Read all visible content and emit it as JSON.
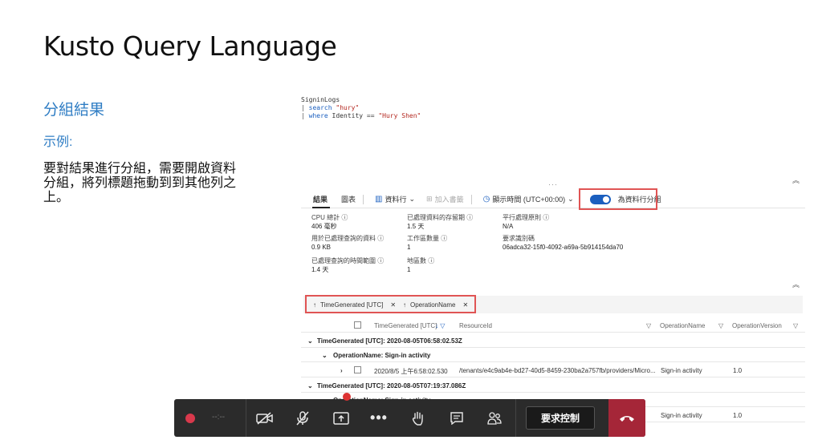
{
  "slide": {
    "title": "Kusto Query Language",
    "heading": "分組結果",
    "example_label": "示例:",
    "body": "要對結果進行分組，需要開啟資料分組，將列標題拖動到到其他列之上。"
  },
  "query": {
    "line1": "SigninLogs",
    "line2_kw": "search",
    "line2_str": "\"hury\"",
    "line3_kw": "where",
    "line3_mid": " Identity == ",
    "line3_str": "\"Hury Shen\""
  },
  "toolbar": {
    "results_tab": "結果",
    "chart_tab": "圖表",
    "columns": "資料行",
    "add_bookmark": "加入書籤",
    "time_display": "顯示時間 (UTC+00:00)",
    "group_toggle": "為資料行分組",
    "group_toggle_on": true
  },
  "stats": {
    "cpu_label": "CPU 總計 ⓘ",
    "cpu_value": "406 毫秒",
    "data_label": "用於已處理查詢的資料 ⓘ",
    "data_value": "0.9 KB",
    "range_label": "已處理查詢的時間範圍 ⓘ",
    "range_value": "1.4 天",
    "retention_label": "已處理資料的存留期 ⓘ",
    "retention_value": "1.5 天",
    "workspaces_label": "工作區數量 ⓘ",
    "workspaces_value": "1",
    "regions_label": "地區數 ⓘ",
    "regions_value": "1",
    "parallel_label": "平行處理原則 ⓘ",
    "parallel_value": "N/A",
    "request_label": "要求識別碼",
    "request_value": "06adca32-15f0-4092-a69a-5b914154da70"
  },
  "grouping": {
    "chip1": "TimeGenerated [UTC]",
    "chip2": "OperationName"
  },
  "table": {
    "headers": {
      "time": "TimeGenerated [UTC]",
      "resource": "ResourceId",
      "operation": "OperationName",
      "version": "OperationVersion"
    },
    "group1": "TimeGenerated [UTC]: 2020-08-05T06:58:02.53Z",
    "subgroup1": "OperationName: Sign-in activity",
    "row1": {
      "time": "2020/8/5 上午6:58:02.530",
      "resource": "/tenants/e4c9ab4e-bd27-40d5-8459-230ba2a757fb/providers/Micro...",
      "operation": "Sign-in activity",
      "version": "1.0"
    },
    "group2": "TimeGenerated [UTC]: 2020-08-05T07:19:37.086Z",
    "subgroup2": "OperationName: Sign-in activity",
    "row2": {
      "operation": "Sign-in activity",
      "version": "1.0"
    }
  },
  "callbar": {
    "timer": "--:--",
    "request_control": "要求控制"
  }
}
